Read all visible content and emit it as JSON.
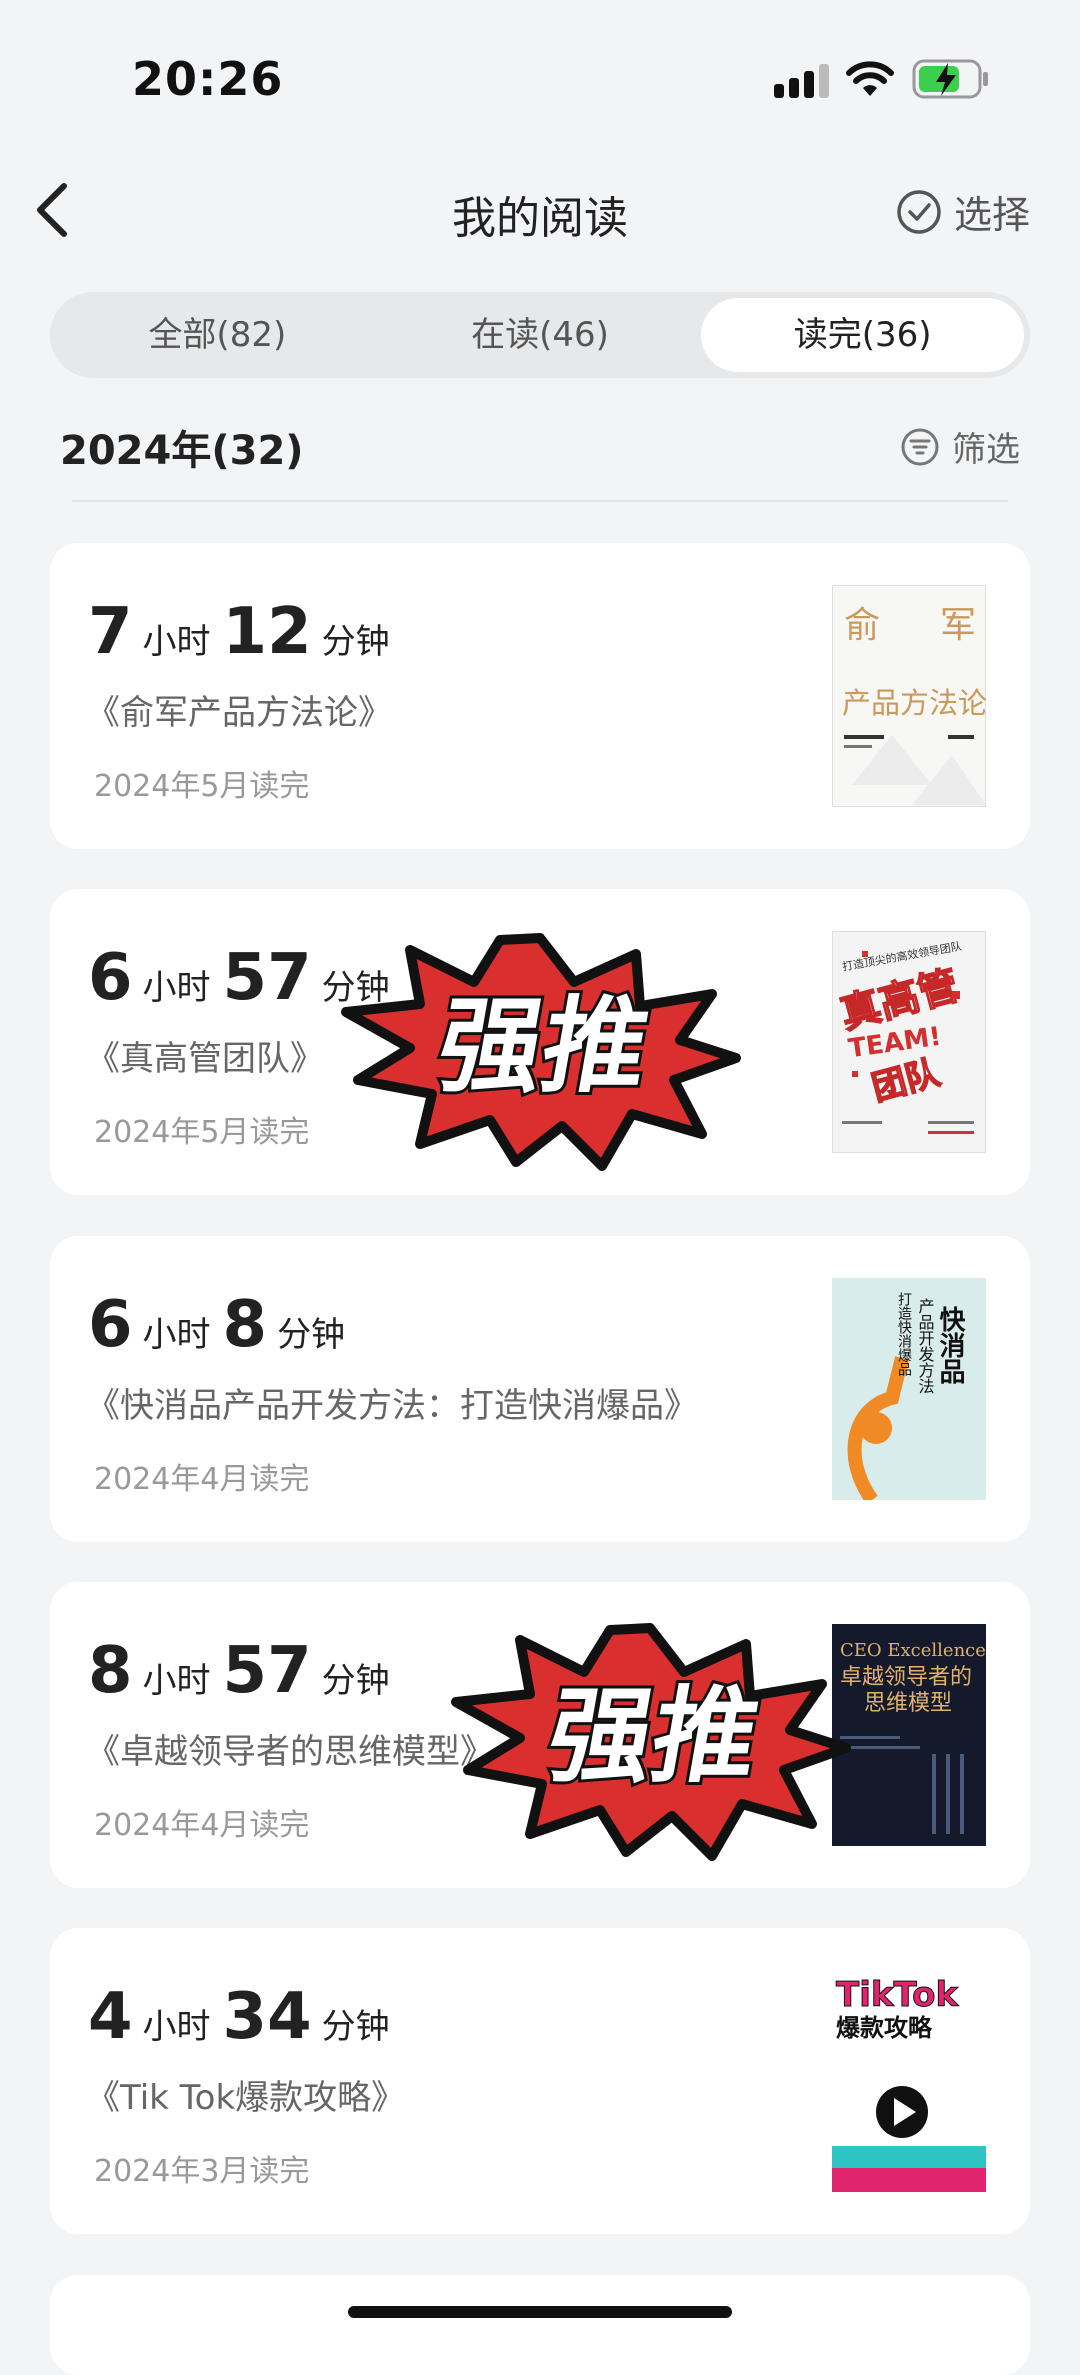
{
  "status_bar": {
    "time": "20:26"
  },
  "nav": {
    "title": "我的阅读",
    "select_label": "选择"
  },
  "tabs": [
    {
      "label": "全部(82)"
    },
    {
      "label": "在读(46)"
    },
    {
      "label": "读完(36)"
    }
  ],
  "active_tab": 2,
  "section": {
    "year_label": "2024年(32)",
    "filter_label": "筛选"
  },
  "units": {
    "hours": "小时",
    "minutes": "分钟"
  },
  "books": [
    {
      "hours": "7",
      "minutes": "12",
      "title": "《俞军产品方法论》",
      "finished": "2024年5月读完"
    },
    {
      "hours": "6",
      "minutes": "57",
      "title": "《真高管团队》",
      "finished": "2024年5月读完"
    },
    {
      "hours": "6",
      "minutes": "8",
      "title": "《快消品产品开发方法：打造快消爆品》",
      "finished": "2024年4月读完"
    },
    {
      "hours": "8",
      "minutes": "57",
      "title": "《卓越领导者的思维模型》",
      "finished": "2024年4月读完"
    },
    {
      "hours": "4",
      "minutes": "34",
      "title": "《Tik Tok爆款攻略》",
      "finished": "2024年3月读完"
    }
  ],
  "covers": [
    {
      "line1": "俞",
      "line2": "军",
      "line3": "产品方法论"
    },
    {
      "top": "打造顶尖的高效领导团队",
      "line1": "真高管",
      "line2": "TEAM!",
      "line3": "团队"
    },
    {
      "line1": "快消品",
      "line2": "产品开发方法",
      "line3": "打造快消爆品"
    },
    {
      "line1": "CEO Excellence",
      "line2": "卓越领导者的",
      "line3": "思维模型"
    },
    {
      "line1": "TikTok",
      "line2": "爆款攻略"
    }
  ],
  "stickers": [
    {
      "text": "强推"
    },
    {
      "text": "强推"
    }
  ],
  "colors": {
    "background": "#f3f4f6",
    "card": "#ffffff",
    "sticker_red": "#d92f2f"
  }
}
